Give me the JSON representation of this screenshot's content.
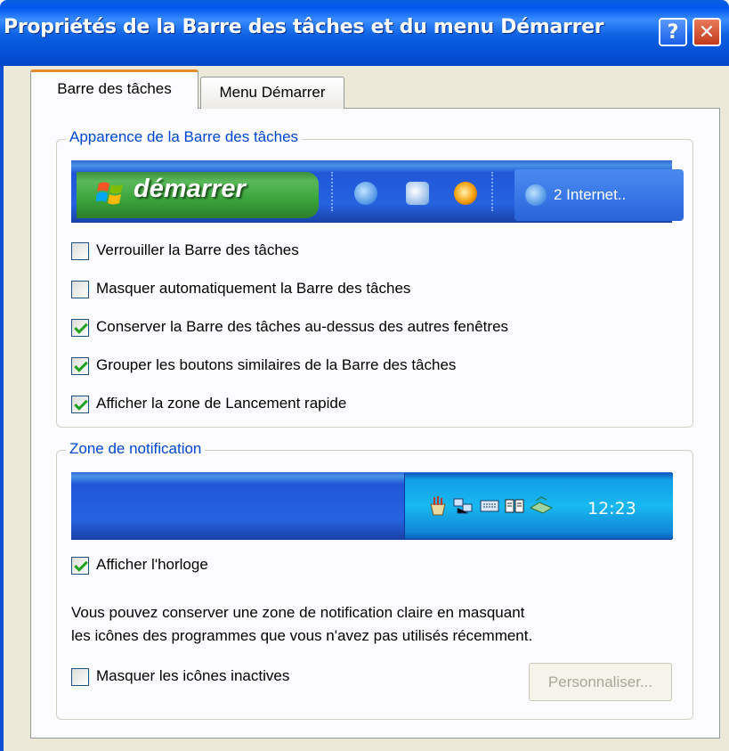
{
  "window": {
    "title": "Propriétés de la Barre des tâches et du menu Démarrer",
    "help_glyph": "?",
    "close_glyph": "✕"
  },
  "tabs": [
    {
      "label": "Barre des tâches",
      "active": true
    },
    {
      "label": "Menu Démarrer",
      "active": false
    }
  ],
  "appearance": {
    "group_label": "Apparence de la Barre des tâches",
    "start_label": "démarrer",
    "task_button_label": "2 Internet..",
    "options": [
      {
        "label": "Verrouiller la Barre des tâches",
        "checked": false
      },
      {
        "label": "Masquer automatiquement la Barre des tâches",
        "checked": false
      },
      {
        "label": "Conserver la Barre des tâches au-dessus des autres fenêtres",
        "checked": true
      },
      {
        "label": "Grouper les boutons similaires de la Barre des tâches",
        "checked": true
      },
      {
        "label": "Afficher la zone de Lancement rapide",
        "checked": true
      }
    ]
  },
  "notification": {
    "group_label": "Zone de notification",
    "clock_time": "12:23",
    "show_clock": {
      "label": "Afficher l'horloge",
      "checked": true
    },
    "description_line1": "Vous pouvez conserver une zone de notification claire en masquant",
    "description_line2": "les icônes des programmes que vous n'avez pas utilisés récemment.",
    "hide_inactive": {
      "label": "Masquer les icônes inactives",
      "checked": false
    },
    "customize_button": "Personnaliser..."
  },
  "colors": {
    "title_bar": "#0a5fe0",
    "group_label": "#0046d5",
    "start_button": "#3aa53a",
    "tab_highlight": "#e68b2c"
  }
}
